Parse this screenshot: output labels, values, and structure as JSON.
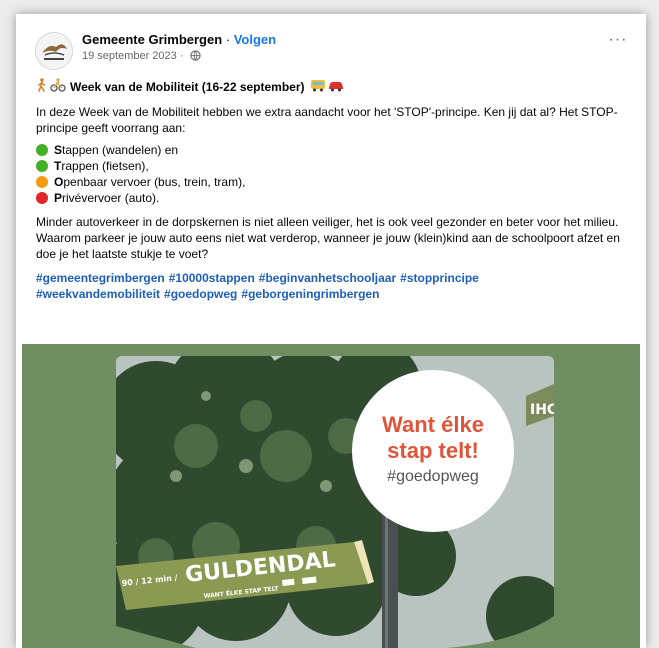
{
  "post": {
    "author": "Gemeente Grimbergen",
    "separator": " · ",
    "follow_label": "Volgen",
    "date": "19 september 2023 · ",
    "more_label": "···",
    "title": "Week van de Mobiliteit (16-22 september)",
    "intro": "In deze Week van de Mobiliteit hebben we extra aandacht voor het 'STOP'-principe. Ken jij dat al? Het STOP-principe geeft voorrang aan:",
    "items": [
      {
        "first": "S",
        "rest": "tappen (wandelen) en",
        "color": "#43b02a"
      },
      {
        "first": "T",
        "rest": "rappen (fietsen),",
        "color": "#43b02a"
      },
      {
        "first": "O",
        "rest": "penbaar vervoer (bus, trein, tram),",
        "color": "#f39c12"
      },
      {
        "first": "P",
        "rest": "rivévervoer (auto).",
        "color": "#e02626"
      }
    ],
    "body": "Minder autoverkeer in de dorpskernen is niet alleen veiliger, het is ook veel gezonder en beter voor het milieu. Waarom parkeer je jouw auto eens niet wat verderop, wanneer je jouw (klein)kind aan de schoolpoort afzet en doe je het laatste stukje te voet?",
    "hashtags": [
      "#gemeentegrimbergen",
      "#10000stappen",
      "#beginvanhetschooljaar",
      "#stopprincipe",
      "#weekvandemobiliteit",
      "#goedopweg",
      "#geborgeningrimbergen"
    ]
  },
  "image": {
    "badge_line1": "Want élke",
    "badge_line2": "stap telt!",
    "badge_tag": "#goedopweg",
    "sign_name": "GULDENDAL",
    "sign_small_left": "90 / 12 min /",
    "sign_slogan": "WANT ÉLKE STAP TELT",
    "sign_right_fragment": "IHC",
    "background_color": "#6f8f62",
    "accent_color": "#e0553a"
  },
  "icons": {
    "avatar": "grimbergen-logo-icon",
    "globe": "globe-icon",
    "walk": "walking-person-icon",
    "bike": "cyclist-icon",
    "bus": "bus-icon",
    "car": "car-icon"
  }
}
